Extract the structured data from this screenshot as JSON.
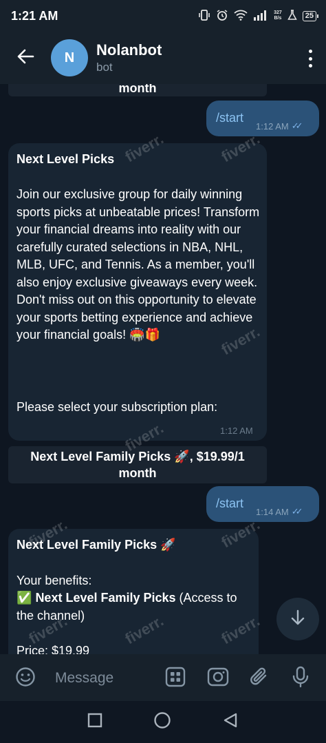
{
  "status": {
    "time": "1:21 AM",
    "net_speed_value": "327",
    "net_speed_unit": "B/s",
    "battery": "25"
  },
  "header": {
    "avatar_letter": "N",
    "title": "Nolanbot",
    "subtitle": "bot"
  },
  "messages": {
    "top_button_cont": "month",
    "out1": {
      "text": "/start",
      "time": "1:12 AM"
    },
    "in1": {
      "title": "Next Level Picks",
      "body": "Join our exclusive group for daily winning sports picks at unbeatable prices! Transform your financial dreams into reality with our carefully curated selections in NBA, NHL, MLB, UFC, and Tennis. As a member, you'll also enjoy exclusive giveaways every week. Don't miss out on this opportunity to elevate your sports betting experience and achieve your financial goals! 🏟️🎁",
      "prompt": "Please select your subscription plan:",
      "time": "1:12 AM"
    },
    "plan_button": {
      "line1": "Next Level Family Picks 🚀, $19.99/1",
      "line2": "month"
    },
    "out2": {
      "text": "/start",
      "time": "1:14 AM"
    },
    "in2": {
      "title": "Next Level Family Picks 🚀",
      "benefits_label": "Your benefits:",
      "benefit_check": "✅",
      "benefit_name": "Next Level Family Picks",
      "benefit_detail": " (Access to the channel)",
      "price": "Price: $19.99"
    }
  },
  "input": {
    "placeholder": "Message"
  },
  "watermark": "fiverr.",
  "colors": {
    "background": "#0e1621",
    "header": "#17212b",
    "incoming_bubble": "#182533",
    "outgoing_bubble": "#2b5278",
    "accent": "#5aa0da"
  }
}
